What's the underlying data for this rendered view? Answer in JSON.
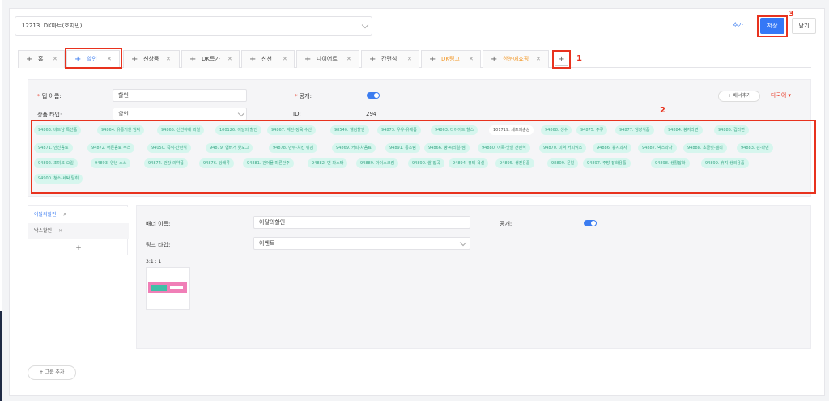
{
  "header": {
    "store_select": "12213. DK마트(호치민)",
    "add_label": "추가",
    "save_label": "저장",
    "close_label": "닫기"
  },
  "tabs": [
    {
      "label": "홈"
    },
    {
      "label": "할인"
    },
    {
      "label": "신상품"
    },
    {
      "label": "DK특가"
    },
    {
      "label": "신선"
    },
    {
      "label": "다이어트"
    },
    {
      "label": "간편식"
    },
    {
      "label": "DK링고"
    },
    {
      "label": "한눈에쇼핑"
    }
  ],
  "annotations": {
    "one": "1",
    "two": "2",
    "three": "3"
  },
  "form": {
    "tab_name_label": "탭 이름:",
    "tab_name_value": "할인",
    "public_label": "공개:",
    "product_type_label": "상품 타입:",
    "product_type_value": "할인",
    "id_label": "ID:",
    "id_value": "294",
    "banner_add_label": "+ 배너추가",
    "multilang_label": "다국어 ▾"
  },
  "chips": [
    "94863. 베트남 특선품",
    "94864. 유통기한 임박",
    "94865. 신선야채 과일",
    "100126. 이달의 할인",
    "94867. 계란-정육 수산",
    "98540. 웰컴할인",
    "94873. 우유-유제품",
    "94863. 다이어트 헬스",
    "101719. 세프의순상",
    "94868. 생수",
    "94875. 주류",
    "94877. 냉장식품",
    "94884. 봉지라면",
    "94885. 컵라면",
    "94871. 안신음료",
    "94872. 어른음료 주스",
    "94050. 즉석-간편식",
    "94879. 햄버거 핫도그",
    "94878. 만두-치킨 튀김",
    "94869. 커피-차음료",
    "94891. 통조림",
    "94866. 빵-씨리얼-잼",
    "94880. 어묵-맛살 간편식",
    "94870. 미역 커피믹스",
    "94886. 봉지과자",
    "94887. 박스과자",
    "94888. 초콜릿-젤리",
    "94883. 김-라면",
    "94892. 조미료-오일",
    "94893. 양념-소스",
    "94874. 건강-의약품",
    "94876. 당배류",
    "94881. 건어물 마른안주",
    "94882. 면-파스타",
    "94889. 아이스크림",
    "94890. 쌀-잡곡",
    "94894. 뷰티-욕실",
    "94895. 생진용품",
    "98809. 문일",
    "94897. 주방-잡화용품",
    "94898. 생활잡화",
    "94899. 휴지-생리용품",
    "94900. 청소-세탁 탈취"
  ],
  "banners": {
    "items": [
      {
        "label": "이달의할인"
      },
      {
        "label": "박스할인"
      }
    ],
    "add_label": "+",
    "banner_name_label": "배너 이름:",
    "banner_name_value": "이달의할인",
    "public_label": "공개:",
    "link_type_label": "링크 타입:",
    "link_type_value": "이벤트",
    "ratio_label": "3:1 : 1"
  },
  "group_add_label": "+ 그룹 추가",
  "colors": {
    "accent": "#3578f6",
    "chip_bg": "#d6f6ee",
    "chip_text": "#3ba887",
    "annotation": "#e8321e"
  }
}
